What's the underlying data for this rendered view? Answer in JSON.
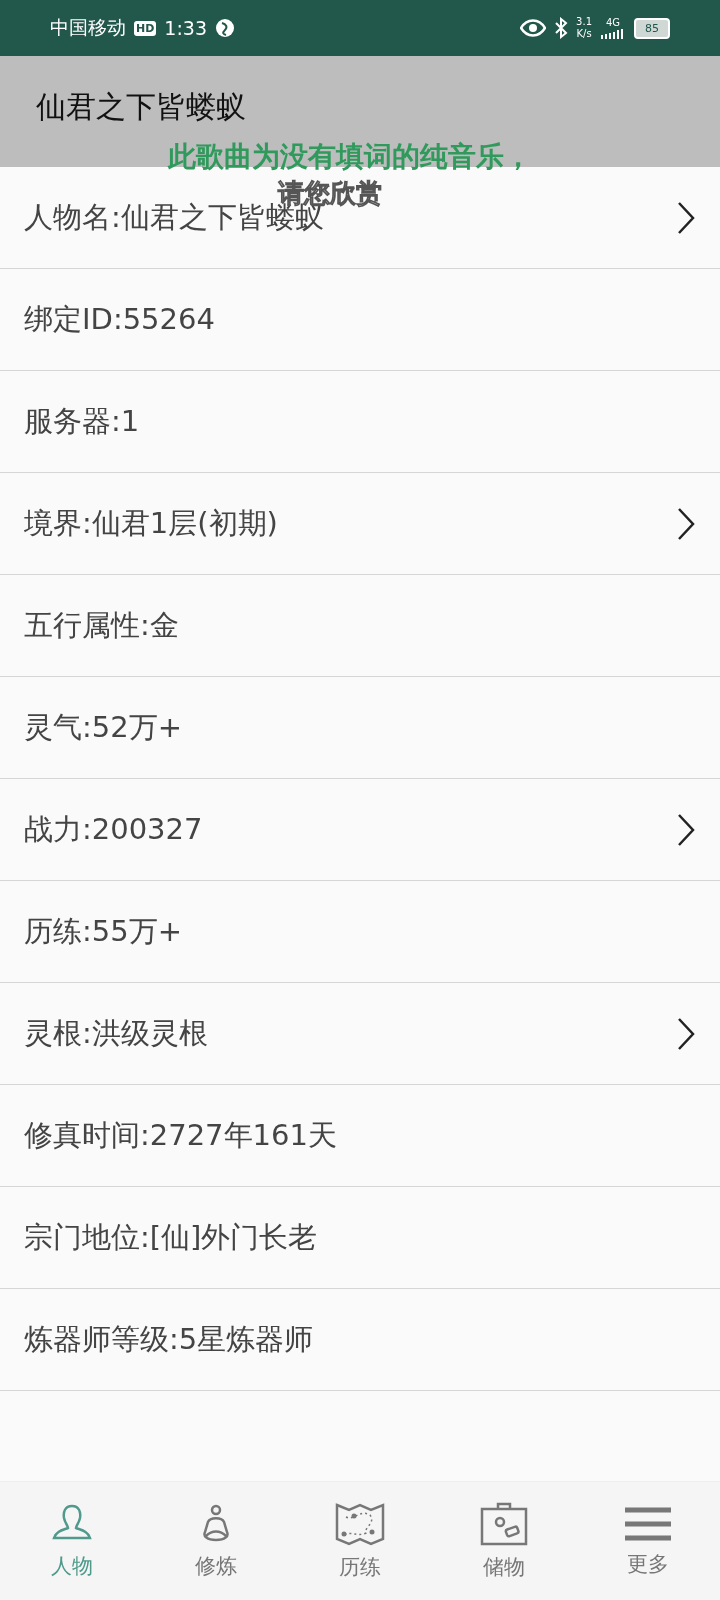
{
  "status_bar": {
    "carrier": "中国移动",
    "hd": "HD",
    "time": "1:33",
    "speed_value": "3.1",
    "speed_unit": "K/s",
    "network": "4G",
    "battery": "85"
  },
  "header": {
    "title": "仙君之下皆蝼蚁"
  },
  "lyrics_overlay": {
    "lines": [
      "此歌曲为没有填词的纯音乐，",
      "请您欣赏"
    ]
  },
  "rows": [
    {
      "text": "人物名:仙君之下皆蝼蚁",
      "arrow": true
    },
    {
      "text": "绑定ID:55264",
      "arrow": false
    },
    {
      "text": "服务器:1",
      "arrow": false
    },
    {
      "text": "境界:仙君1层(初期)",
      "arrow": true
    },
    {
      "text": "五行属性:金",
      "arrow": false
    },
    {
      "text": "灵气:52万+",
      "arrow": false
    },
    {
      "text": "战力:200327",
      "arrow": true
    },
    {
      "text": "历练:55万+",
      "arrow": false
    },
    {
      "text": "灵根:洪级灵根",
      "arrow": true
    },
    {
      "text": "修真时间:2727年161天",
      "arrow": false
    },
    {
      "text": "宗门地位:[仙]外门长老",
      "arrow": false
    },
    {
      "text": "炼器师等级:5星炼器师",
      "arrow": false
    }
  ],
  "bottom_nav": [
    {
      "kind": "person",
      "label": "人物",
      "selected": true
    },
    {
      "kind": "meditate",
      "label": "修炼",
      "selected": false
    },
    {
      "kind": "map",
      "label": "历练",
      "selected": false
    },
    {
      "kind": "bag",
      "label": "储物",
      "selected": false
    },
    {
      "kind": "menu",
      "label": "更多",
      "selected": false
    }
  ]
}
